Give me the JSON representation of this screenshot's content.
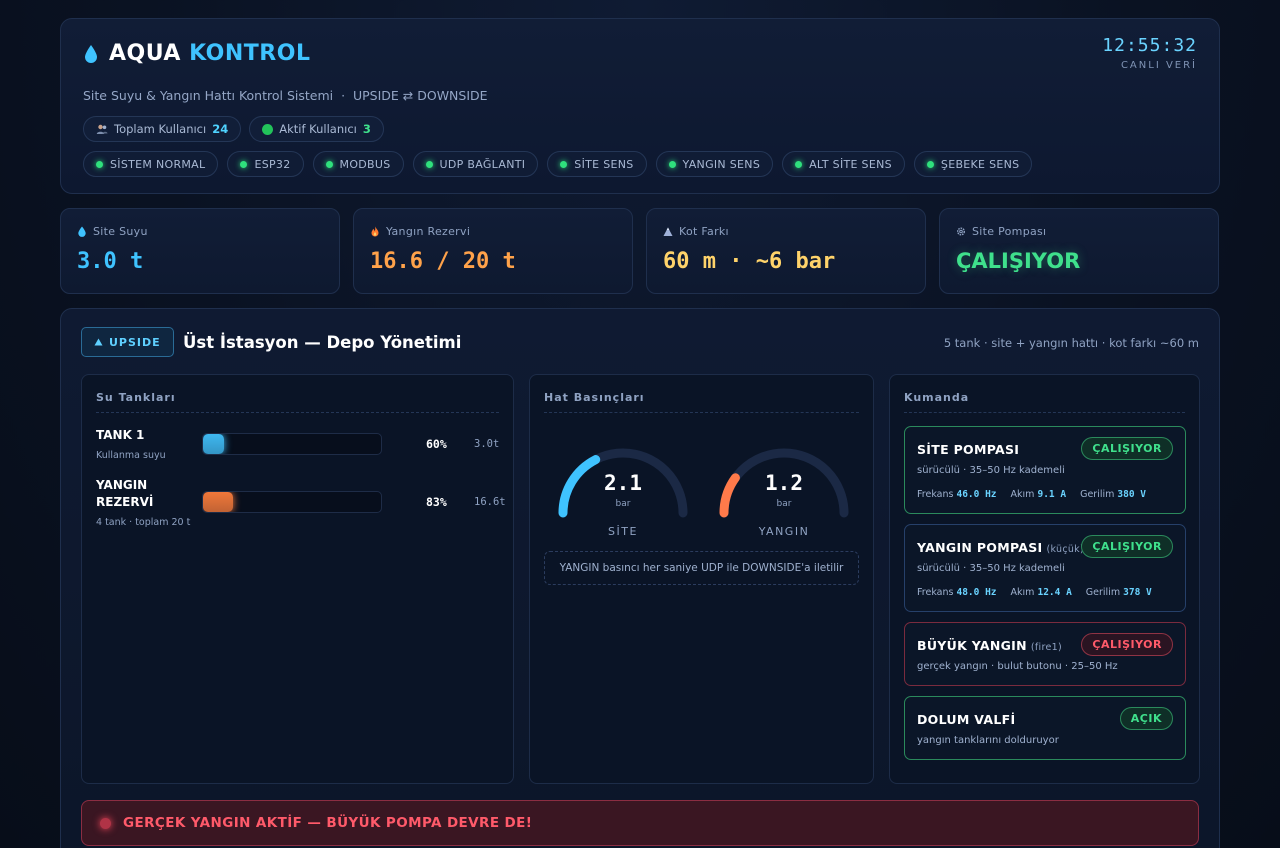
{
  "header": {
    "brand_main": "AQUA",
    "brand_accent": "KONTROL",
    "subtitle": "Site Suyu & Yangın Hattı Kontrol Sistemi  ·  UPSIDE ⇄ DOWNSIDE",
    "clock": "12:55:32",
    "clock_label": "CANLI VERİ",
    "users": {
      "total_label": "Toplam Kullanıcı",
      "total_value": "24",
      "active_label": "Aktif Kullanıcı",
      "active_value": "3"
    },
    "status_items": [
      "SİSTEM NORMAL",
      "ESP32",
      "MODBUS",
      "UDP BAĞLANTI",
      "SİTE SENS",
      "YANGIN SENS",
      "ALT SİTE SENS",
      "ŞEBEKE SENS"
    ]
  },
  "stats": [
    {
      "label": "Site Suyu",
      "value": "3.0 t",
      "icon": "water-drop-icon",
      "color": "#3fc3ff"
    },
    {
      "label": "Yangın Rezervi",
      "value": "16.6 / 20 t",
      "icon": "fire-icon",
      "color": "#ffa24a"
    },
    {
      "label": "Kot Farkı",
      "value": "60 m · ~6 bar",
      "icon": "mountain-icon",
      "color": "#ffd36a"
    },
    {
      "label": "Site Pompası",
      "value": "ÇALIŞIYOR",
      "icon": "gear-icon",
      "color": "#3fe08c"
    }
  ],
  "panel": {
    "badge": "UPSIDE",
    "title": "Üst İstasyon — Depo Yönetimi",
    "meta": "5 tank · site + yangın hattı · kot farkı ~60 m"
  },
  "tanks": {
    "title": "Su Tankları",
    "items": [
      {
        "name": "TANK 1",
        "sub": "Kullanma suyu",
        "level": 0.6,
        "pct": "60%",
        "ton": "3.0t",
        "color": "#3fb8f0"
      },
      {
        "name": "YANGIN REZERVİ",
        "sub": "4 tank · toplam 20 t",
        "level": 0.83,
        "pct": "83%",
        "ton": "16.6t",
        "color": "#f0783a"
      }
    ]
  },
  "pressures": {
    "title": "Hat Basınçları",
    "gauges": [
      {
        "value": "2.1",
        "unit": "bar",
        "name": "SİTE",
        "level": 0.35
      },
      {
        "value": "1.2",
        "unit": "bar",
        "name": "YANGIN",
        "level": 0.2
      }
    ],
    "note": "YANGIN basıncı her saniye UDP ile DOWNSIDE'a iletilir"
  },
  "commands": {
    "title": "Kumanda",
    "site_pump": {
      "title": "SİTE POMPASI",
      "status": "ÇALIŞIYOR",
      "desc": "sürücülü · 35–50 Hz kademeli",
      "freq_label": "Frekans",
      "freq": "46.0 Hz",
      "current_label": "Akım",
      "current": "9.1 A",
      "voltage_label": "Gerilim",
      "voltage": "380 V"
    },
    "fire_pump": {
      "title": "YANGIN POMPASI",
      "title_small": "(küçük)",
      "status": "ÇALIŞIYOR",
      "desc": "sürücülü · 35–50 Hz kademeli",
      "freq_label": "Frekans",
      "freq": "48.0 Hz",
      "current_label": "Akım",
      "current": "12.4 A",
      "voltage_label": "Gerilim",
      "voltage": "378 V"
    },
    "big_fire": {
      "title": "BÜYÜK YANGIN",
      "title_small": "(fire1)",
      "status": "ÇALIŞIYOR",
      "desc": "gerçek yangın · bulut butonu · 25–50 Hz"
    },
    "fill_valve": {
      "title": "DOLUM VALFİ",
      "status": "AÇIK",
      "desc": "yangın tanklarını dolduruyor"
    }
  },
  "alarm": {
    "text": "GERÇEK YANGIN AKTİF — BÜYÜK POMPA DEVRE DE!"
  }
}
